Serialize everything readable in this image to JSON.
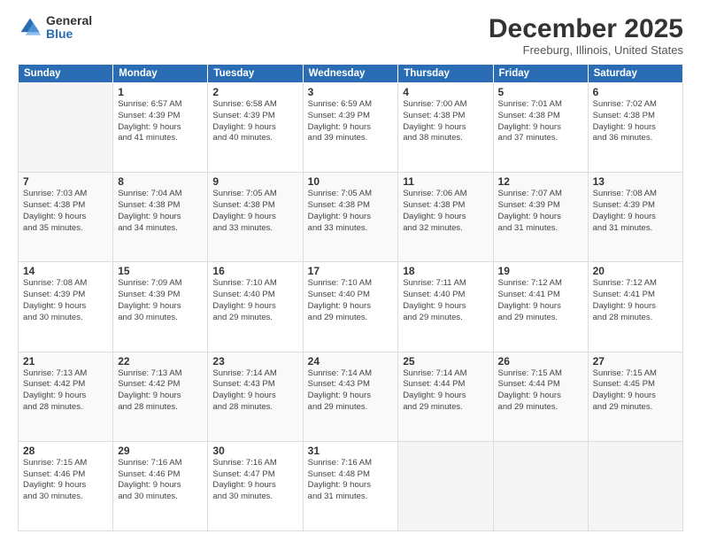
{
  "logo": {
    "general": "General",
    "blue": "Blue"
  },
  "header": {
    "month": "December 2025",
    "location": "Freeburg, Illinois, United States"
  },
  "weekdays": [
    "Sunday",
    "Monday",
    "Tuesday",
    "Wednesday",
    "Thursday",
    "Friday",
    "Saturday"
  ],
  "weeks": [
    [
      {
        "day": "",
        "info": ""
      },
      {
        "day": "1",
        "info": "Sunrise: 6:57 AM\nSunset: 4:39 PM\nDaylight: 9 hours\nand 41 minutes."
      },
      {
        "day": "2",
        "info": "Sunrise: 6:58 AM\nSunset: 4:39 PM\nDaylight: 9 hours\nand 40 minutes."
      },
      {
        "day": "3",
        "info": "Sunrise: 6:59 AM\nSunset: 4:39 PM\nDaylight: 9 hours\nand 39 minutes."
      },
      {
        "day": "4",
        "info": "Sunrise: 7:00 AM\nSunset: 4:38 PM\nDaylight: 9 hours\nand 38 minutes."
      },
      {
        "day": "5",
        "info": "Sunrise: 7:01 AM\nSunset: 4:38 PM\nDaylight: 9 hours\nand 37 minutes."
      },
      {
        "day": "6",
        "info": "Sunrise: 7:02 AM\nSunset: 4:38 PM\nDaylight: 9 hours\nand 36 minutes."
      }
    ],
    [
      {
        "day": "7",
        "info": "Sunrise: 7:03 AM\nSunset: 4:38 PM\nDaylight: 9 hours\nand 35 minutes."
      },
      {
        "day": "8",
        "info": "Sunrise: 7:04 AM\nSunset: 4:38 PM\nDaylight: 9 hours\nand 34 minutes."
      },
      {
        "day": "9",
        "info": "Sunrise: 7:05 AM\nSunset: 4:38 PM\nDaylight: 9 hours\nand 33 minutes."
      },
      {
        "day": "10",
        "info": "Sunrise: 7:05 AM\nSunset: 4:38 PM\nDaylight: 9 hours\nand 33 minutes."
      },
      {
        "day": "11",
        "info": "Sunrise: 7:06 AM\nSunset: 4:38 PM\nDaylight: 9 hours\nand 32 minutes."
      },
      {
        "day": "12",
        "info": "Sunrise: 7:07 AM\nSunset: 4:39 PM\nDaylight: 9 hours\nand 31 minutes."
      },
      {
        "day": "13",
        "info": "Sunrise: 7:08 AM\nSunset: 4:39 PM\nDaylight: 9 hours\nand 31 minutes."
      }
    ],
    [
      {
        "day": "14",
        "info": "Sunrise: 7:08 AM\nSunset: 4:39 PM\nDaylight: 9 hours\nand 30 minutes."
      },
      {
        "day": "15",
        "info": "Sunrise: 7:09 AM\nSunset: 4:39 PM\nDaylight: 9 hours\nand 30 minutes."
      },
      {
        "day": "16",
        "info": "Sunrise: 7:10 AM\nSunset: 4:40 PM\nDaylight: 9 hours\nand 29 minutes."
      },
      {
        "day": "17",
        "info": "Sunrise: 7:10 AM\nSunset: 4:40 PM\nDaylight: 9 hours\nand 29 minutes."
      },
      {
        "day": "18",
        "info": "Sunrise: 7:11 AM\nSunset: 4:40 PM\nDaylight: 9 hours\nand 29 minutes."
      },
      {
        "day": "19",
        "info": "Sunrise: 7:12 AM\nSunset: 4:41 PM\nDaylight: 9 hours\nand 29 minutes."
      },
      {
        "day": "20",
        "info": "Sunrise: 7:12 AM\nSunset: 4:41 PM\nDaylight: 9 hours\nand 28 minutes."
      }
    ],
    [
      {
        "day": "21",
        "info": "Sunrise: 7:13 AM\nSunset: 4:42 PM\nDaylight: 9 hours\nand 28 minutes."
      },
      {
        "day": "22",
        "info": "Sunrise: 7:13 AM\nSunset: 4:42 PM\nDaylight: 9 hours\nand 28 minutes."
      },
      {
        "day": "23",
        "info": "Sunrise: 7:14 AM\nSunset: 4:43 PM\nDaylight: 9 hours\nand 28 minutes."
      },
      {
        "day": "24",
        "info": "Sunrise: 7:14 AM\nSunset: 4:43 PM\nDaylight: 9 hours\nand 29 minutes."
      },
      {
        "day": "25",
        "info": "Sunrise: 7:14 AM\nSunset: 4:44 PM\nDaylight: 9 hours\nand 29 minutes."
      },
      {
        "day": "26",
        "info": "Sunrise: 7:15 AM\nSunset: 4:44 PM\nDaylight: 9 hours\nand 29 minutes."
      },
      {
        "day": "27",
        "info": "Sunrise: 7:15 AM\nSunset: 4:45 PM\nDaylight: 9 hours\nand 29 minutes."
      }
    ],
    [
      {
        "day": "28",
        "info": "Sunrise: 7:15 AM\nSunset: 4:46 PM\nDaylight: 9 hours\nand 30 minutes."
      },
      {
        "day": "29",
        "info": "Sunrise: 7:16 AM\nSunset: 4:46 PM\nDaylight: 9 hours\nand 30 minutes."
      },
      {
        "day": "30",
        "info": "Sunrise: 7:16 AM\nSunset: 4:47 PM\nDaylight: 9 hours\nand 30 minutes."
      },
      {
        "day": "31",
        "info": "Sunrise: 7:16 AM\nSunset: 4:48 PM\nDaylight: 9 hours\nand 31 minutes."
      },
      {
        "day": "",
        "info": ""
      },
      {
        "day": "",
        "info": ""
      },
      {
        "day": "",
        "info": ""
      }
    ]
  ]
}
